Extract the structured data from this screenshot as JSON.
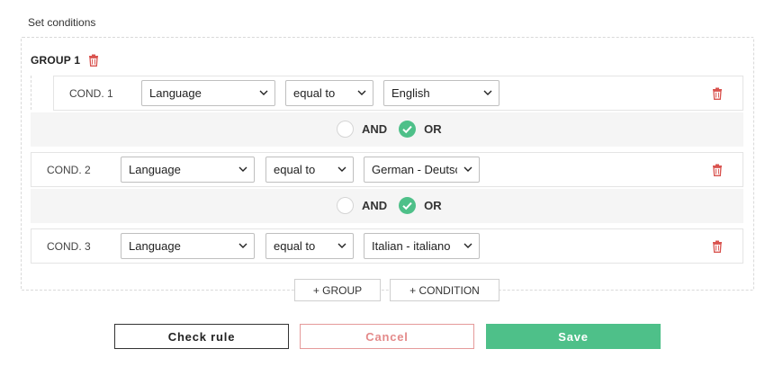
{
  "section_label": "Set conditions",
  "group": {
    "title": "GROUP 1",
    "delete_icon": "trash-icon"
  },
  "conditions": [
    {
      "label": "COND. 1",
      "field": "Language",
      "operator": "equal to",
      "value": "English"
    },
    {
      "label": "COND. 2",
      "field": "Language",
      "operator": "equal to",
      "value": "German - Deutsch"
    },
    {
      "label": "COND. 3",
      "field": "Language",
      "operator": "equal to",
      "value": "Italian - italiano"
    }
  ],
  "connectors": [
    {
      "and_label": "AND",
      "or_label": "OR",
      "selected": "OR"
    },
    {
      "and_label": "AND",
      "or_label": "OR",
      "selected": "OR"
    }
  ],
  "actions": {
    "add_group": "+ GROUP",
    "add_condition": "+ CONDITION",
    "check_rule": "Check rule",
    "cancel": "Cancel",
    "save": "Save"
  },
  "colors": {
    "accent_green": "#4ec089",
    "danger_red": "#d9534f",
    "cancel_red": "#e48a8a"
  }
}
